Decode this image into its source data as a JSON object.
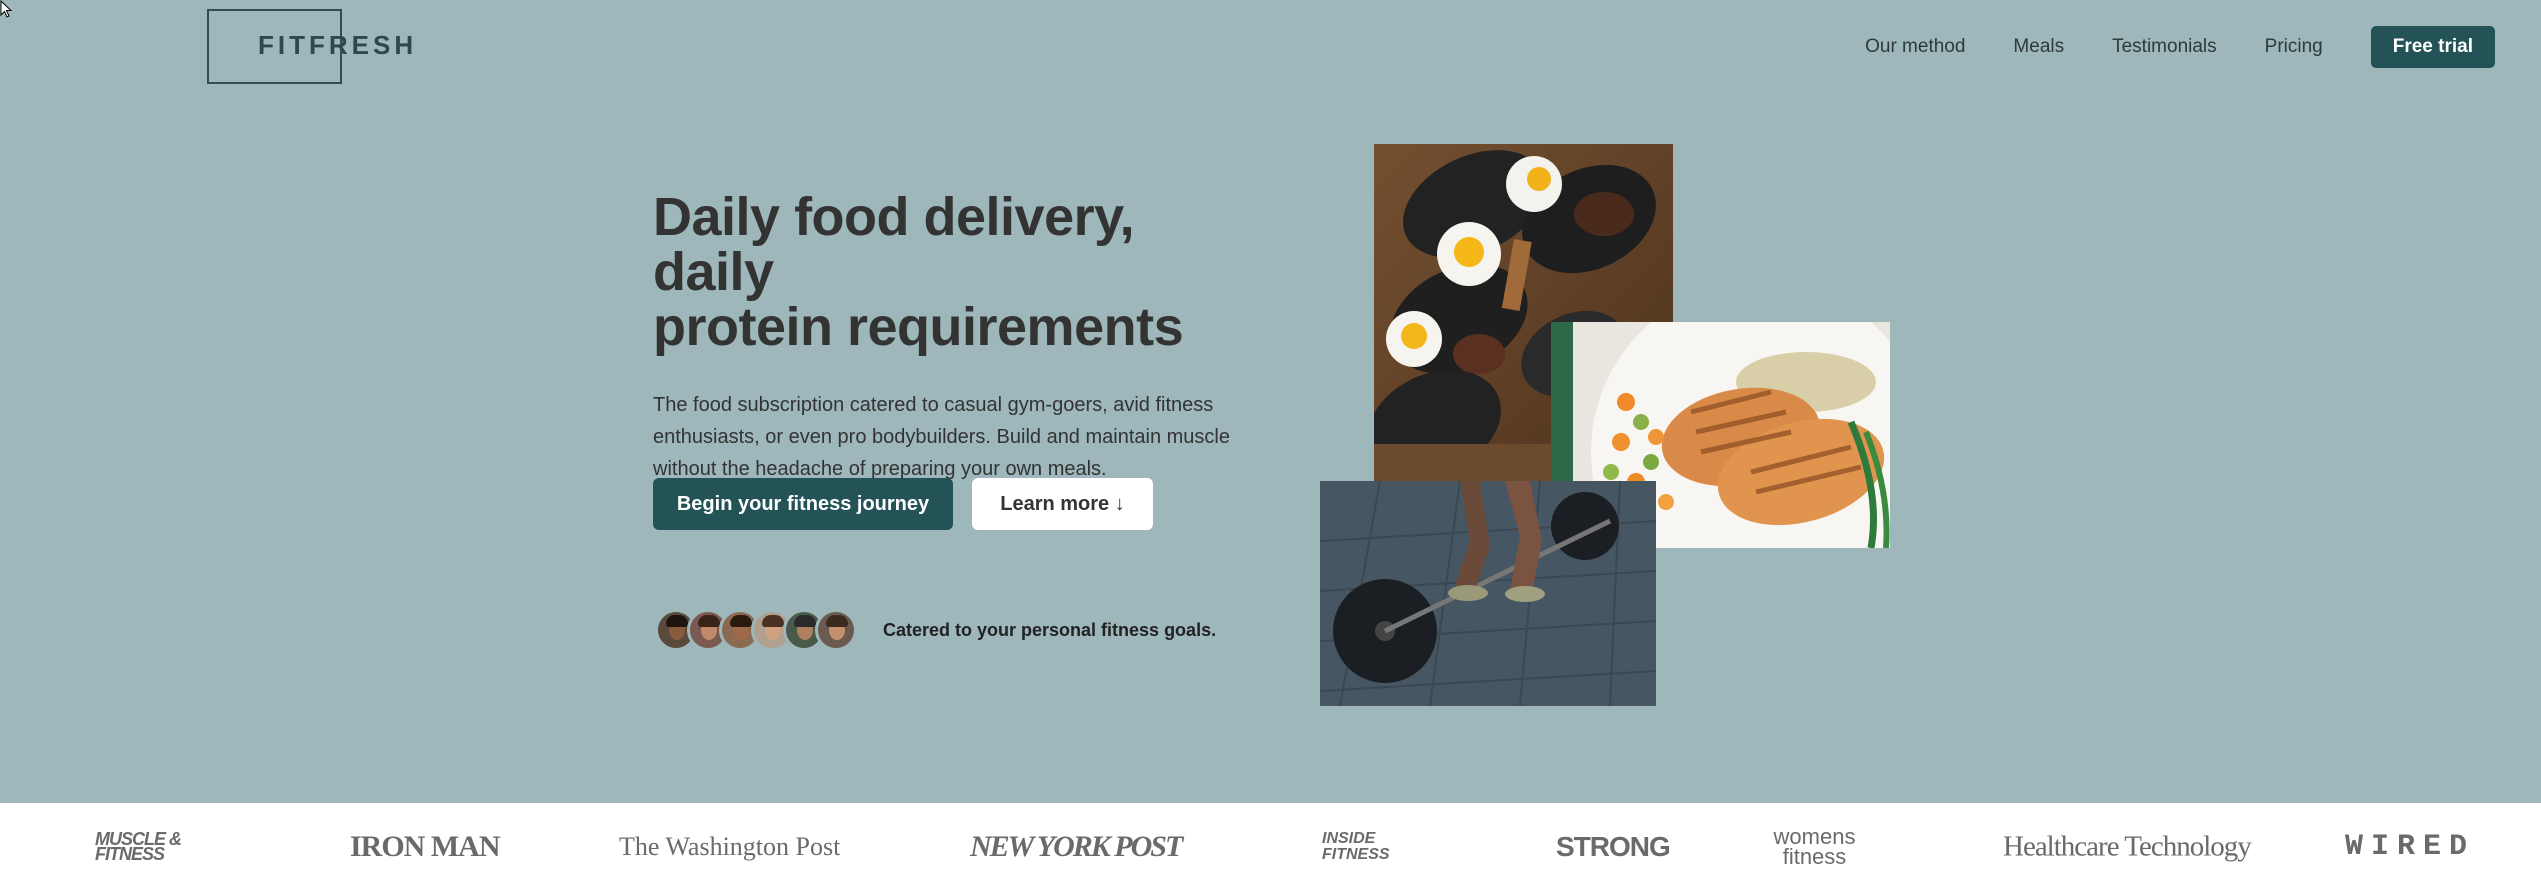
{
  "brand": {
    "name": "FITFRESH"
  },
  "nav": {
    "links": [
      "Our method",
      "Meals",
      "Testimonials",
      "Pricing"
    ],
    "cta": "Free trial"
  },
  "hero": {
    "title_line1": "Daily food delivery, daily",
    "title_line2": "protein requirements",
    "description": "The food subscription catered to casual gym-goers, avid fitness enthusiasts, or even pro bodybuilders. Build and maintain muscle without the headache of preparing your own meals.",
    "primary_cta": "Begin your fitness journey",
    "secondary_cta": "Learn more ↓",
    "social_proof": "Catered to your personal fitness goals."
  },
  "press_logos": [
    "MUSCLE & FITNESS",
    "IRON MAN",
    "The Washington Post",
    "NEW YORK POST",
    "INSIDE FITNESS",
    "STRONG",
    "womens fitness",
    "Healthcare Technology",
    "WIRED"
  ],
  "colors": {
    "background": "#9eb7ba",
    "accent": "#235357",
    "text": "#333333",
    "press_bar": "#ffffff"
  },
  "icons": [
    "cursor-icon",
    "down-arrow-icon"
  ]
}
